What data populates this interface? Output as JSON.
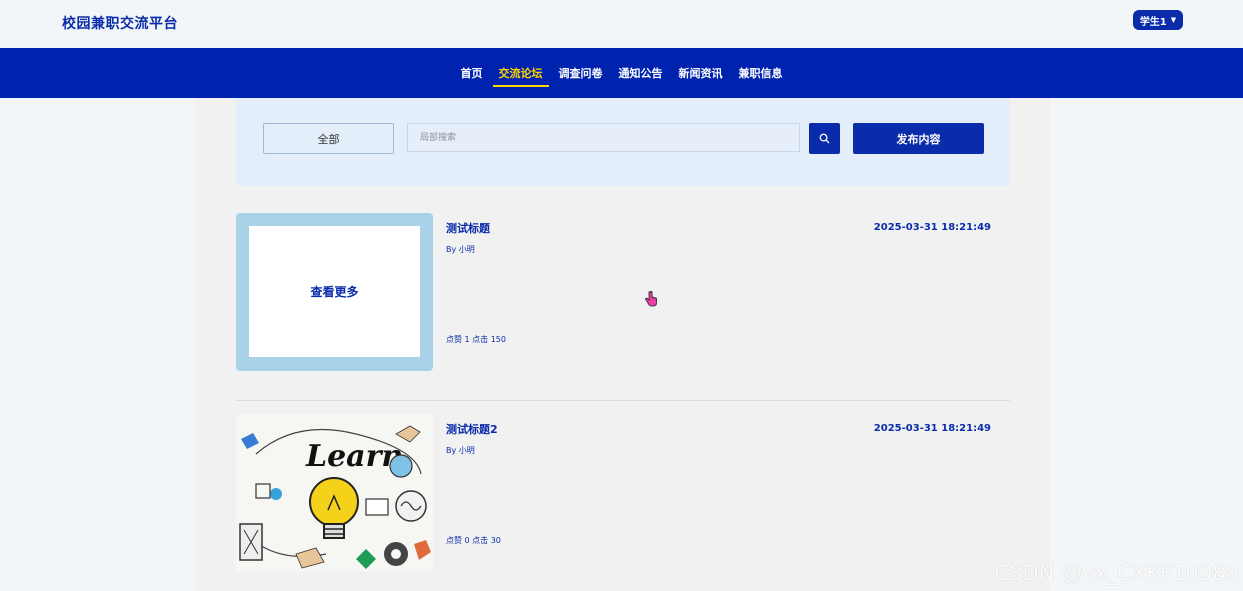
{
  "header": {
    "site_title": "校园兼职交流平台",
    "user_label": "学生1"
  },
  "nav": {
    "items": [
      "首页",
      "交流论坛",
      "调查问卷",
      "通知公告",
      "新闻资讯",
      "兼职信息"
    ],
    "active_index": 1
  },
  "filter": {
    "category_label": "全部",
    "search_placeholder": "局部搜索",
    "search_value": "",
    "publish_label": "发布内容"
  },
  "posts": [
    {
      "title": "测试标题",
      "author": "By 小明",
      "stats": "点赞 1  点击 150",
      "time": "2025-03-31 18:21:49",
      "thumb_text": "查看更多"
    },
    {
      "title": "测试标题2",
      "author": "By 小明",
      "stats": "点赞 0  点击 30",
      "time": "2025-03-31 18:21:49",
      "image_word": "Learn"
    }
  ],
  "watermark": "CSDN @vx_CXKF10088",
  "colors": {
    "brand": "#0a2cab",
    "nav_bg": "#0023af",
    "active": "#ffd400"
  }
}
